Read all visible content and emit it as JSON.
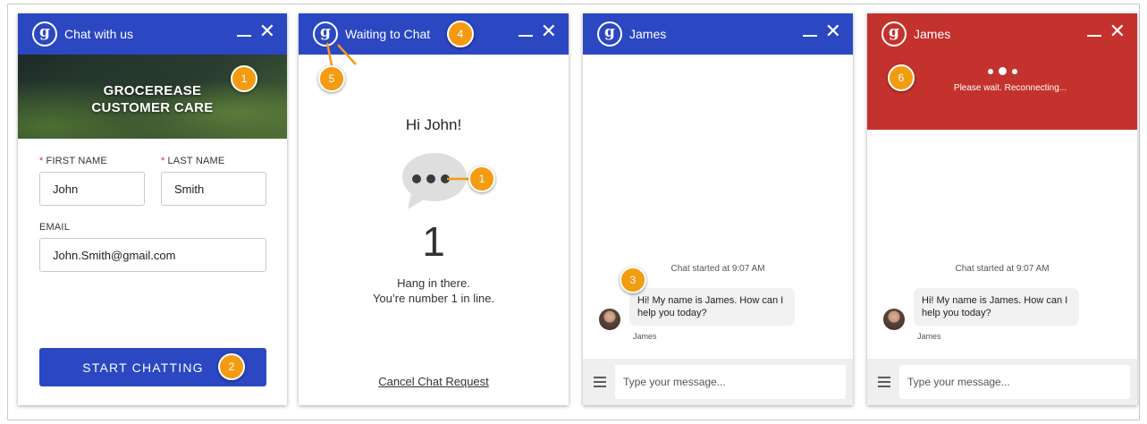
{
  "colors": {
    "primary": "#2b47c1",
    "alert": "#c4322d",
    "callout": "#f39c12"
  },
  "logo_letter": "g",
  "prechat": {
    "title": "Chat with us",
    "banner_line1": "GROCEREASE",
    "banner_line2": "CUSTOMER CARE",
    "required_mark": "*",
    "first_name_label": "FIRST NAME",
    "first_name_value": "John",
    "last_name_label": "LAST NAME",
    "last_name_value": "Smith",
    "email_label": "EMAIL",
    "email_value": "John.Smith@gmail.com",
    "start_button": "START CHATTING"
  },
  "waiting": {
    "title": "Waiting to Chat",
    "greeting": "Hi John!",
    "queue_position": "1",
    "hang_line1": "Hang in there.",
    "hang_line2": "You’re number 1 in line.",
    "cancel_link": "Cancel Chat Request"
  },
  "chat": {
    "title": "James",
    "started": "Chat started at 9:07 AM",
    "message": "Hi! My name is James. How can I help you today?",
    "agent_name": "James",
    "composer_placeholder": "Type your message..."
  },
  "reconnecting": {
    "title": "James",
    "status": "Please wait. Reconnecting...",
    "started": "Chat started at 9:07 AM",
    "message": "Hi! My name is James. How can I help you today?",
    "agent_name": "James",
    "composer_placeholder": "Type your message..."
  },
  "callouts": {
    "c1a": "1",
    "c2": "2",
    "c1b": "1",
    "c4": "4",
    "c5": "5",
    "c3": "3",
    "c6": "6"
  },
  "window_controls": {
    "minimize": "—",
    "close": "✕"
  }
}
